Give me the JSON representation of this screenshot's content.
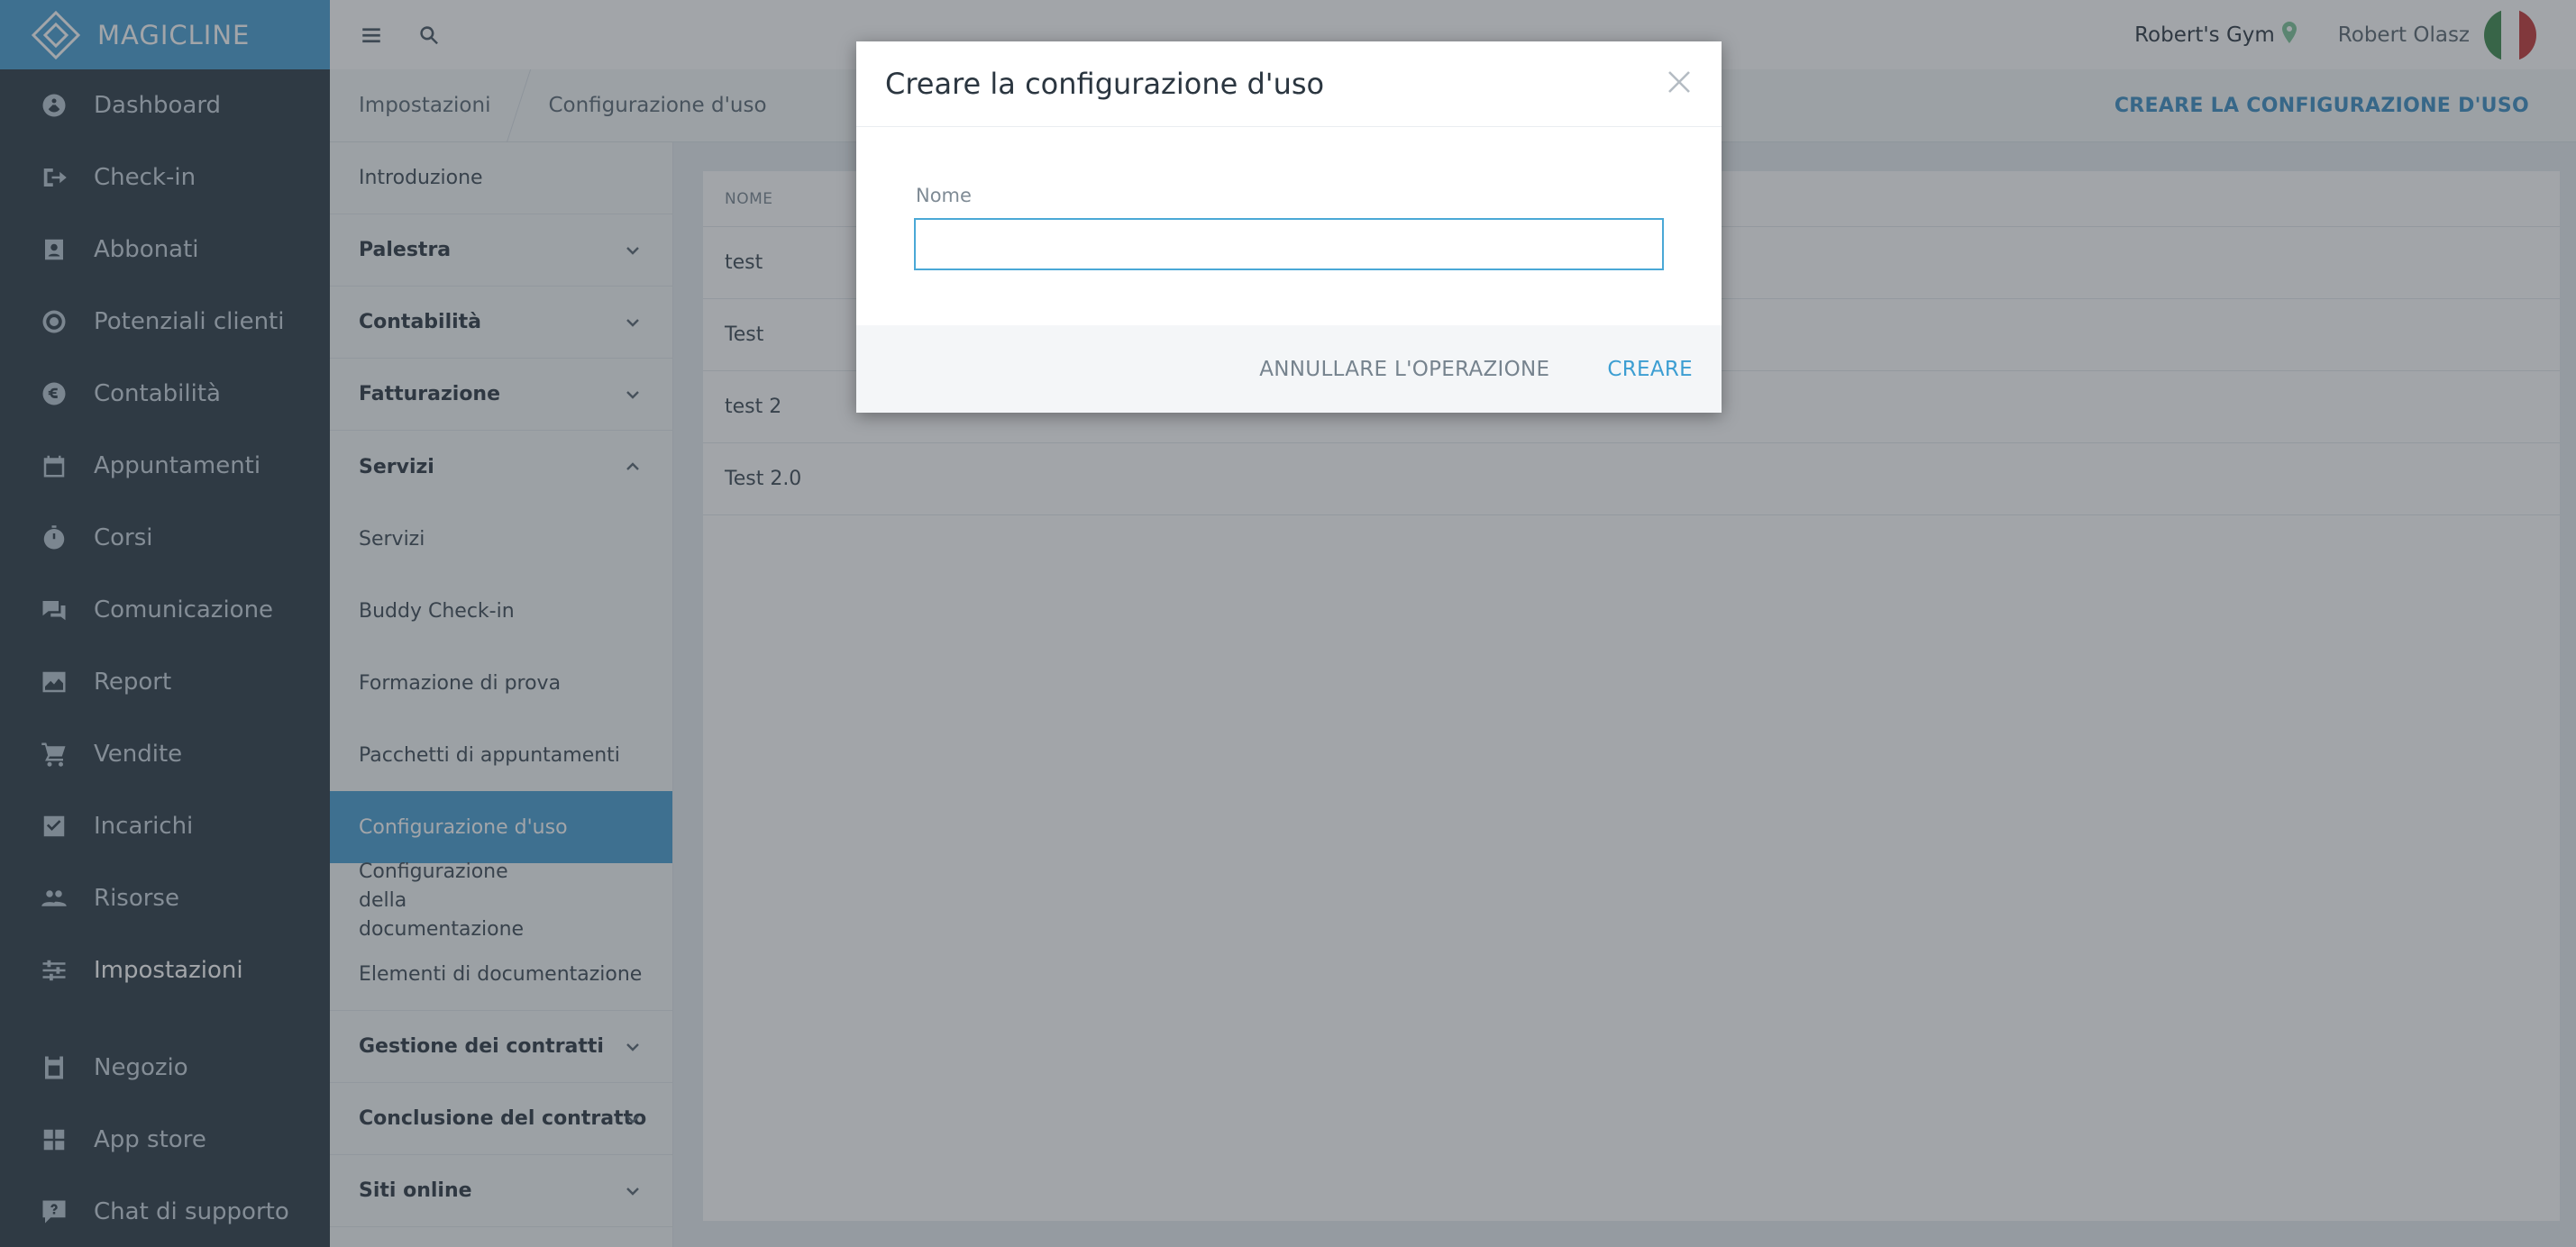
{
  "app": {
    "brand": "MAGICLINE"
  },
  "sidebar": {
    "items": [
      {
        "label": "Dashboard",
        "icon": "dashboard-icon"
      },
      {
        "label": "Check-in",
        "icon": "check-in-icon"
      },
      {
        "label": "Abbonati",
        "icon": "members-icon"
      },
      {
        "label": "Potenziali clienti",
        "icon": "leads-icon"
      },
      {
        "label": "Contabilità",
        "icon": "euro-icon"
      },
      {
        "label": "Appuntamenti",
        "icon": "calendar-icon"
      },
      {
        "label": "Corsi",
        "icon": "stopwatch-icon"
      },
      {
        "label": "Comunicazione",
        "icon": "chat-icon"
      },
      {
        "label": "Report",
        "icon": "chart-icon"
      },
      {
        "label": "Vendite",
        "icon": "cart-icon"
      },
      {
        "label": "Incarichi",
        "icon": "checkbox-icon"
      },
      {
        "label": "Risorse",
        "icon": "people-icon"
      },
      {
        "label": "Impostazioni",
        "icon": "sliders-icon",
        "active": true
      },
      {
        "label": "Negozio",
        "icon": "store-icon"
      },
      {
        "label": "App store",
        "icon": "apps-icon"
      },
      {
        "label": "Chat di supporto",
        "icon": "support-chat-icon"
      }
    ]
  },
  "topbar": {
    "gym": "Robert's Gym",
    "user": "Robert Olasz"
  },
  "breadcrumb": {
    "items": [
      "Impostazioni",
      "Configurazione d'uso"
    ],
    "action": "CREARE LA CONFIGURAZIONE D'USO"
  },
  "submenu": {
    "intro": "Introduzione",
    "palestra": "Palestra",
    "contabilita": "Contabilità",
    "fatturazione": "Fatturazione",
    "servizi": "Servizi",
    "servizi_children": [
      "Servizi",
      "Buddy Check-in",
      "Formazione di prova",
      "Pacchetti di appuntamenti",
      "Configurazione d'uso",
      "Configurazione della documentazione",
      "Elementi di documentazione"
    ],
    "gestione": "Gestione dei contratti",
    "conclusione": "Conclusione del contratto",
    "siti": "Siti online"
  },
  "table": {
    "header": "NOME",
    "rows": [
      "test",
      "Test",
      "test 2",
      "Test 2.0"
    ]
  },
  "modal": {
    "title": "Creare la configurazione d'uso",
    "field_label": "Nome",
    "field_value": "",
    "cancel": "ANNULLARE L'OPERAZIONE",
    "create": "CREARE"
  },
  "colors": {
    "accent": "#4a9fd1",
    "sidebar": "#2f3d48",
    "create_button": "#3c9ed2"
  }
}
